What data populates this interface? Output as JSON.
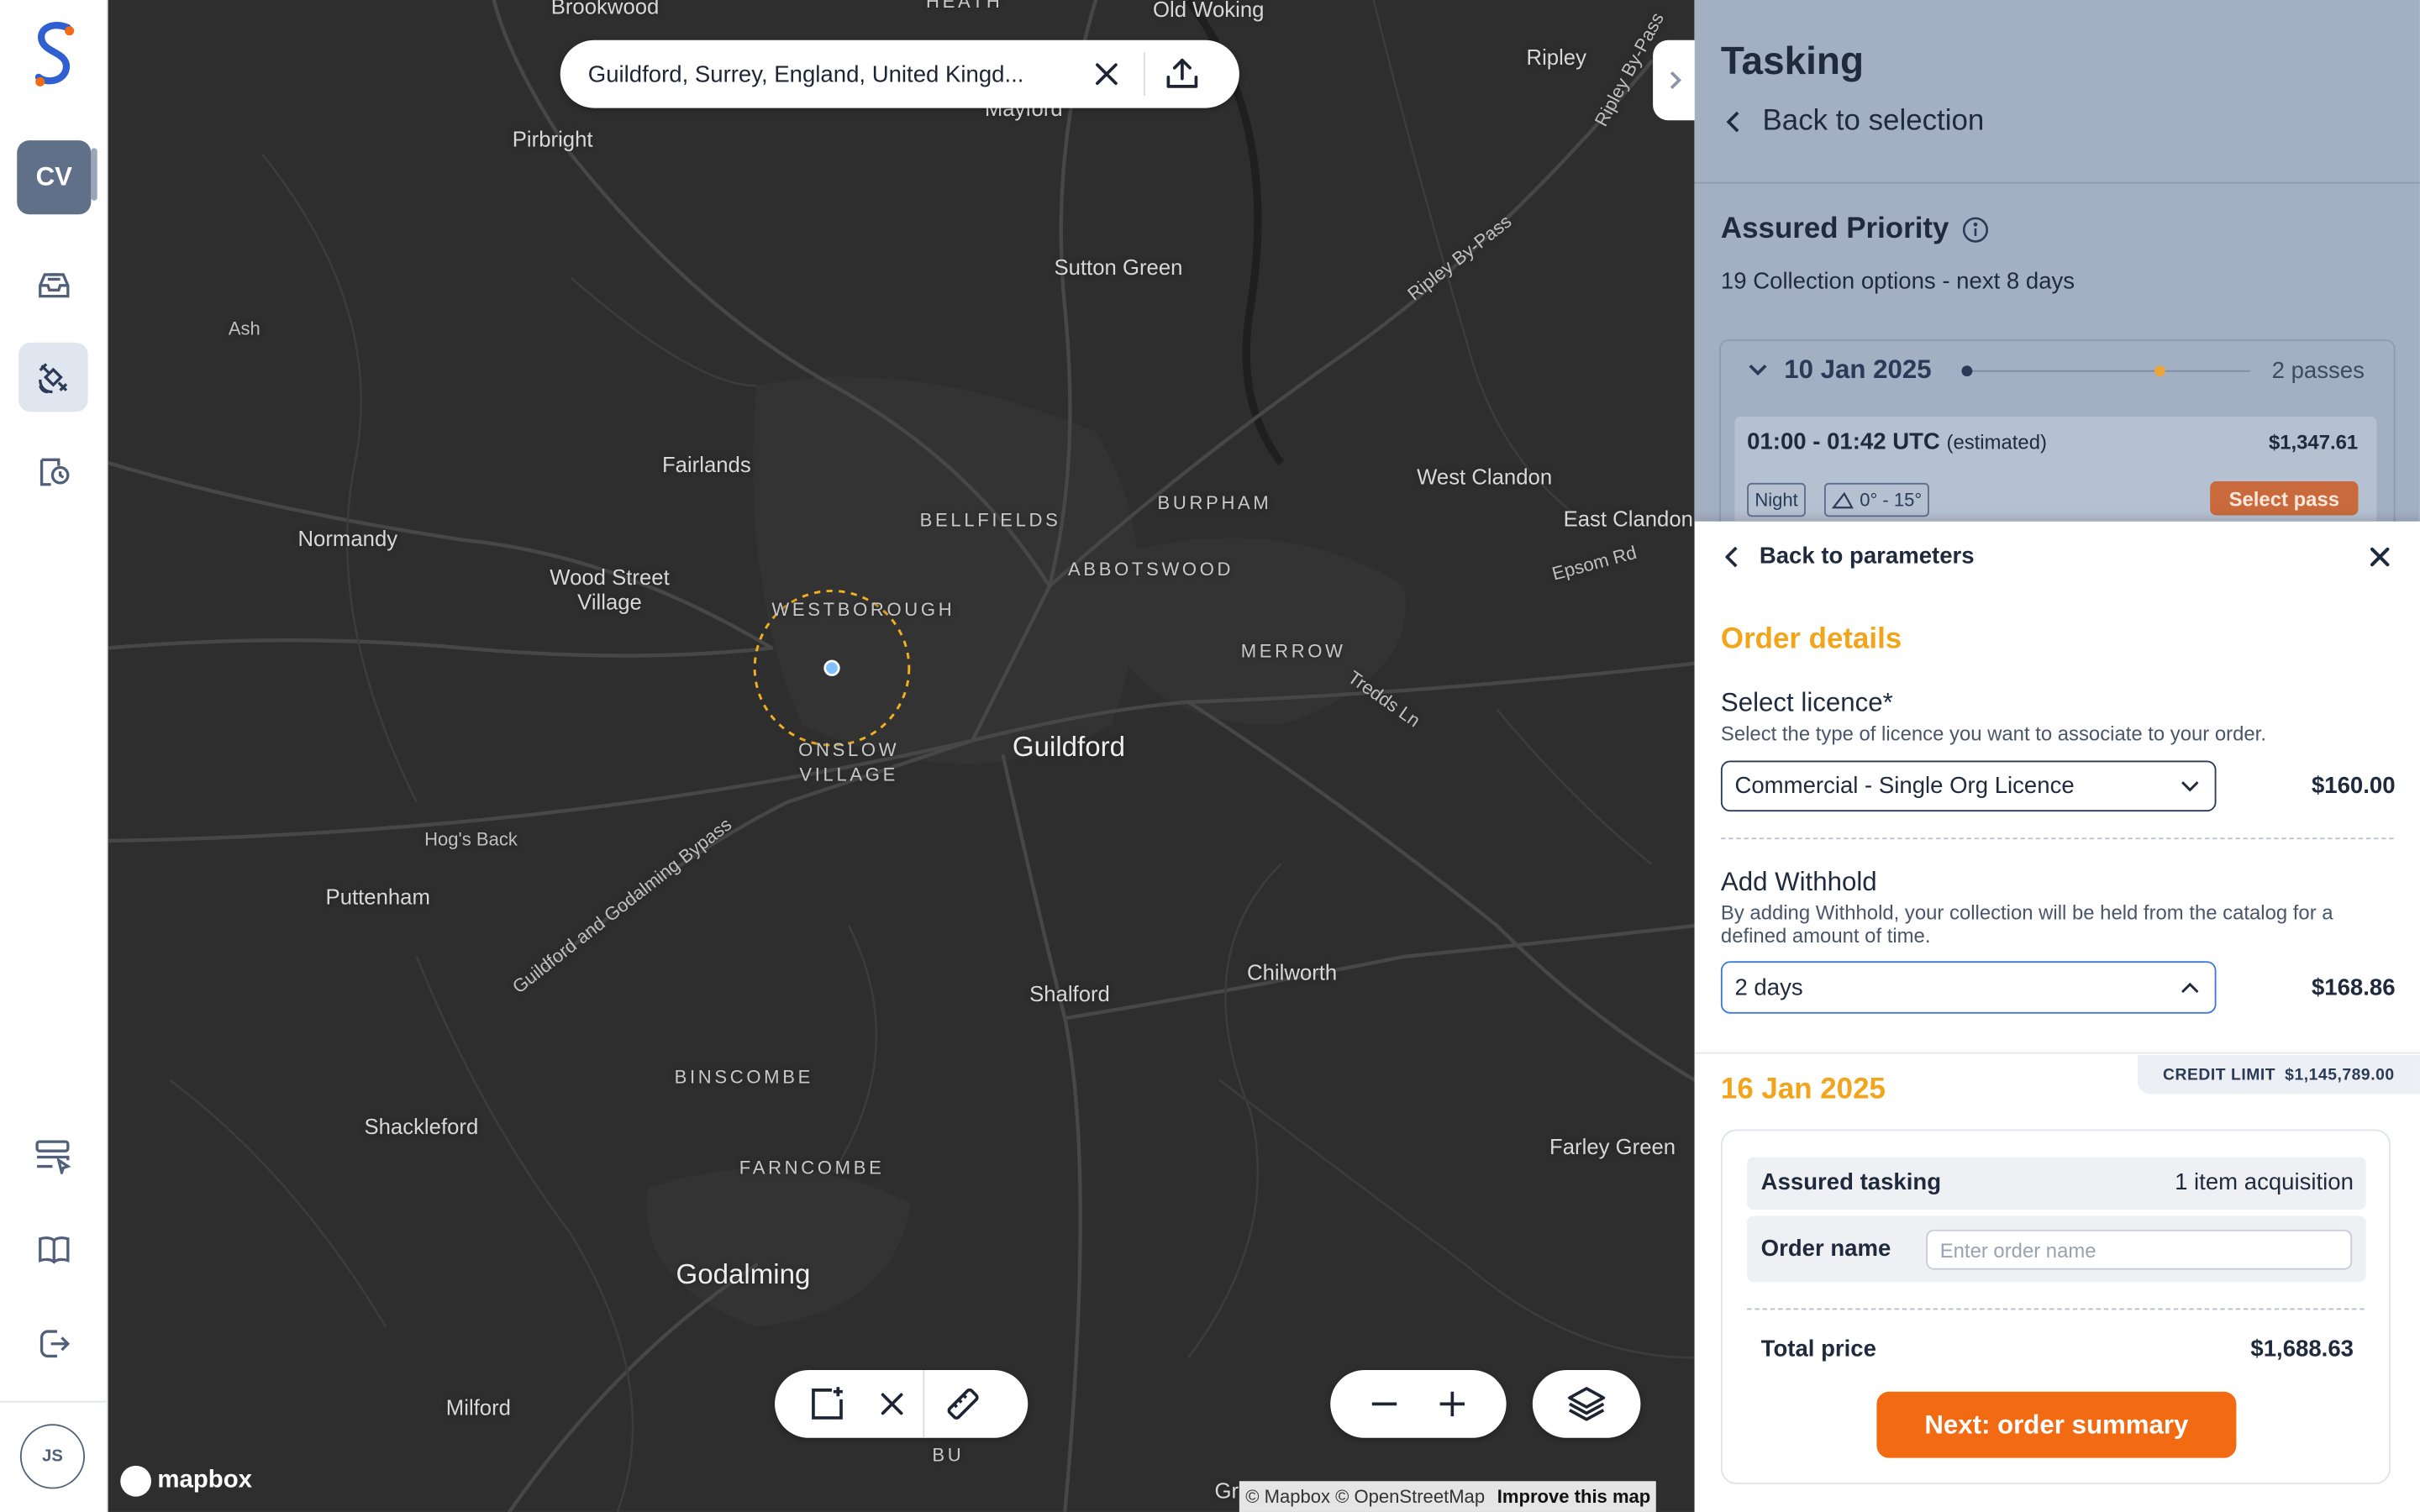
{
  "rail": {
    "workspace_initials": "CV",
    "user_initials": "JS"
  },
  "map": {
    "search_value": "Guildford, Surrey, England, United Kingd...",
    "places": [
      {
        "name": "Brookwood",
        "kind": "normal"
      },
      {
        "name": "HEATH",
        "kind": "caps"
      },
      {
        "name": "Old Woking",
        "kind": "normal"
      },
      {
        "name": "Ripley",
        "kind": "normal"
      },
      {
        "name": "Ripley By-Pass",
        "kind": "small"
      },
      {
        "name": "Pirbright",
        "kind": "normal"
      },
      {
        "name": "Mayford",
        "kind": "normal"
      },
      {
        "name": "Sutton Green",
        "kind": "normal"
      },
      {
        "name": "Ripley By-Pass",
        "kind": "small"
      },
      {
        "name": "Ash",
        "kind": "small"
      },
      {
        "name": "Fairlands",
        "kind": "normal"
      },
      {
        "name": "BELLFIELDS",
        "kind": "caps"
      },
      {
        "name": "BURPHAM",
        "kind": "caps"
      },
      {
        "name": "West Clandon",
        "kind": "normal"
      },
      {
        "name": "East Clandon",
        "kind": "normal"
      },
      {
        "name": "Normandy",
        "kind": "normal"
      },
      {
        "name": "Epsom Rd",
        "kind": "small"
      },
      {
        "name": "Wood Street\nVillage",
        "kind": "normal"
      },
      {
        "name": "ABBOTSWOOD",
        "kind": "caps"
      },
      {
        "name": "WESTBOROUGH",
        "kind": "caps"
      },
      {
        "name": "MERROW",
        "kind": "caps"
      },
      {
        "name": "Tredds Ln",
        "kind": "small"
      },
      {
        "name": "ONSLOW\nVILLAGE",
        "kind": "caps"
      },
      {
        "name": "Guildford",
        "kind": "big"
      },
      {
        "name": "Hog's Back",
        "kind": "small"
      },
      {
        "name": "Guildford and Godalming Bypass",
        "kind": "small"
      },
      {
        "name": "Puttenham",
        "kind": "normal"
      },
      {
        "name": "Chilworth",
        "kind": "normal"
      },
      {
        "name": "Shalford",
        "kind": "normal"
      },
      {
        "name": "BINSCOMBE",
        "kind": "caps"
      },
      {
        "name": "Shackleford",
        "kind": "normal"
      },
      {
        "name": "FARNCOMBE",
        "kind": "caps"
      },
      {
        "name": "Farley Green",
        "kind": "normal"
      },
      {
        "name": "Godalming",
        "kind": "big"
      },
      {
        "name": "Milford",
        "kind": "normal"
      },
      {
        "name": "BU",
        "kind": "caps"
      },
      {
        "name": "Gr",
        "kind": "normal"
      }
    ],
    "logo_text": "mapbox",
    "attribution": "© Mapbox © OpenStreetMap",
    "improve_link": "Improve this map"
  },
  "panel": {
    "title": "Tasking",
    "back_to_selection": "Back to selection",
    "assured_priority_title": "Assured Priority",
    "collection_options": "19 Collection options - next 8 days",
    "pass_group": {
      "date": "10 Jan 2025",
      "passes": "2 passes",
      "time": "01:00 - 01:42 UTC",
      "estimated": "(estimated)",
      "price": "$1,347.61",
      "chip_night": "Night",
      "chip_angle": "0° - 15°",
      "select_pass": "Select pass"
    }
  },
  "order_details": {
    "back_to_parameters": "Back to parameters",
    "title": "Order details",
    "licence_label": "Select licence*",
    "licence_help": "Select the type of licence you want to associate to your order.",
    "licence_value": "Commercial - Single Org Licence",
    "licence_price": "$160.00",
    "withhold_label": "Add Withhold",
    "withhold_help": "By adding Withhold, your collection will be held from the catalog for a defined amount of time.",
    "withhold_value": "2 days",
    "withhold_price": "$168.86"
  },
  "summary": {
    "credit_label": "CREDIT LIMIT",
    "credit_value": "$1,145,789.00",
    "date": "16 Jan 2025",
    "assured_tasking_label": "Assured tasking",
    "assured_tasking_value": "1 item acquisition",
    "order_name_label": "Order name",
    "order_name_placeholder": "Enter order name",
    "order_name_value": "",
    "total_label": "Total price",
    "total_value": "$1,688.63",
    "next_button": "Next: order summary"
  },
  "colors": {
    "accent_orange": "#f26a12",
    "heading_yellow": "#f2a51a",
    "map_background": "#2e2e2e",
    "panel_overlay": "#a3afc2"
  }
}
